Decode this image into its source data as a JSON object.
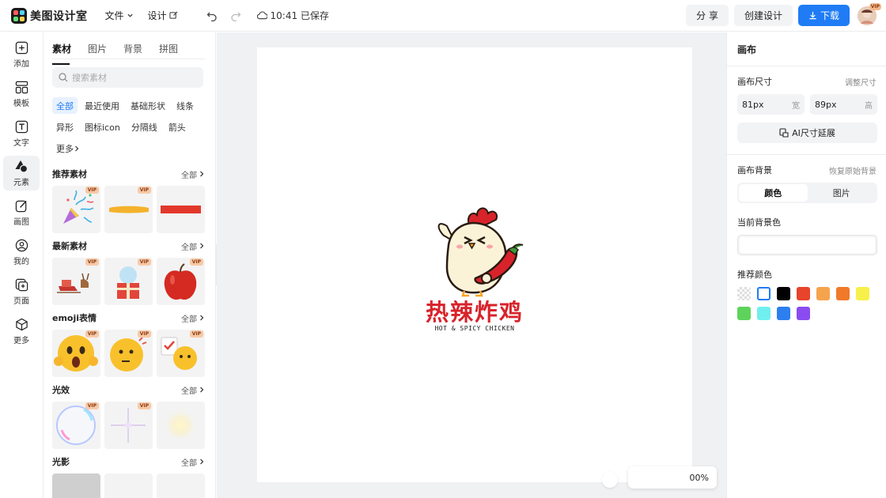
{
  "header": {
    "app_name": "美图设计室",
    "menus": [
      {
        "label": "文件"
      },
      {
        "label": "设计"
      }
    ],
    "save_status": "10:41 已保存",
    "share_label": "分 享",
    "create_label": "创建设计",
    "download_label": "下载",
    "avatar_badge": "VIP"
  },
  "rail": {
    "items": [
      {
        "label": "添加",
        "icon": "plus-square-icon"
      },
      {
        "label": "模板",
        "icon": "template-icon"
      },
      {
        "label": "文字",
        "icon": "text-icon"
      },
      {
        "label": "元素",
        "icon": "shapes-icon"
      },
      {
        "label": "画图",
        "icon": "edit-icon"
      },
      {
        "label": "我的",
        "icon": "user-icon"
      },
      {
        "label": "页面",
        "icon": "page-add-icon"
      },
      {
        "label": "更多",
        "icon": "cube-icon"
      }
    ],
    "active_index": 3
  },
  "panel": {
    "tabs": [
      {
        "label": "素材"
      },
      {
        "label": "图片"
      },
      {
        "label": "背景"
      },
      {
        "label": "拼图"
      }
    ],
    "search_placeholder": "搜索素材",
    "chips": [
      {
        "label": "全部"
      },
      {
        "label": "最近使用"
      },
      {
        "label": "基础形状"
      },
      {
        "label": "线条"
      },
      {
        "label": "异形"
      },
      {
        "label": "图标icon"
      },
      {
        "label": "分隔线"
      },
      {
        "label": "箭头"
      },
      {
        "label": "更多"
      }
    ],
    "view_all": "全部",
    "vip_badge": "VIP",
    "sections": [
      {
        "title": "推荐素材"
      },
      {
        "title": "最新素材"
      },
      {
        "title": "emoji表情"
      },
      {
        "title": "光效"
      },
      {
        "title": "光影"
      }
    ]
  },
  "canvas": {
    "logo_title": "热辣炸鸡",
    "logo_subtitle": "HOT & SPICY CHICKEN",
    "zoom": "00%"
  },
  "right_panel": {
    "title": "画布",
    "canvas_size_label": "画布尺寸",
    "resize_link": "调整尺寸",
    "width_value": "81px",
    "width_unit": "宽",
    "height_value": "89px",
    "height_unit": "高",
    "ai_extend_label": "AI尺寸延展",
    "bg_label": "画布背景",
    "restore_bg_link": "恢复原始背景",
    "seg_color": "颜色",
    "seg_image": "图片",
    "current_bg_label": "当前背景色",
    "recommended_label": "推荐颜色",
    "swatches": [
      "transparent",
      "#ffffff",
      "#000000",
      "#e8432b",
      "#f5a44c",
      "#f07a2a",
      "#f7f04a",
      "#5ed35c",
      "#6ff0ef",
      "#2d7ff0",
      "#8a4cf0"
    ]
  }
}
